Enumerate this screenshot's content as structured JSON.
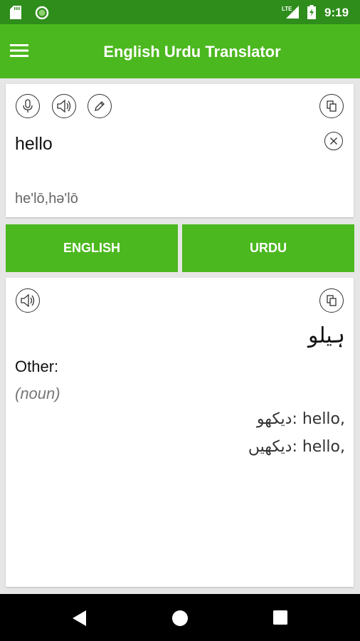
{
  "status": {
    "time": "9:19",
    "network": "LTE"
  },
  "app": {
    "title": "English Urdu Translator"
  },
  "input": {
    "text": "hello",
    "phonetic": "he'lō,hə'lō"
  },
  "languages": {
    "source": "ENGLISH",
    "target": "URDU"
  },
  "output": {
    "translation": "ہیلو",
    "other_label": "Other:",
    "part_of_speech": "(noun)",
    "alternatives": [
      "دیکھو: hello,",
      "دیکھیں: hello,"
    ]
  },
  "colors": {
    "status_bar": "#2e8d1b",
    "primary": "#4cb81f",
    "background": "#e6e6e6"
  }
}
